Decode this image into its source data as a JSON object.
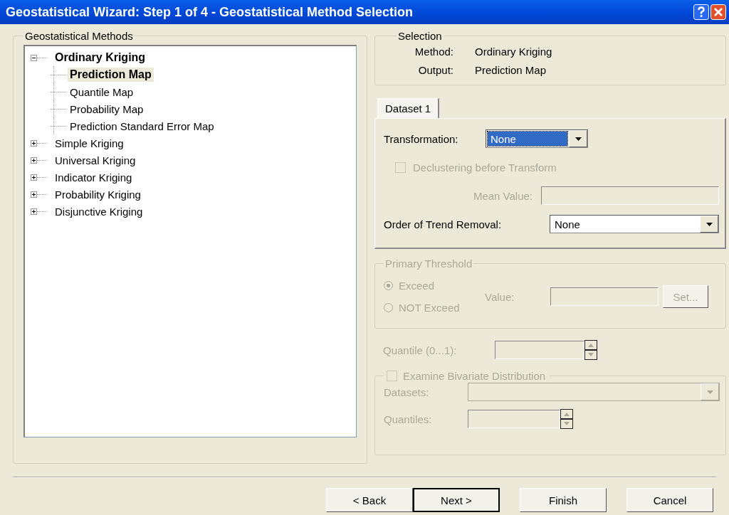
{
  "window": {
    "title": "Geostatistical Wizard: Step 1 of 4 - Geostatistical Method Selection"
  },
  "methods": {
    "title": "Geostatistical Methods",
    "tree": [
      {
        "label": "Ordinary Kriging",
        "expanded": true,
        "selected": false,
        "children": [
          {
            "label": "Prediction Map",
            "selected": true
          },
          {
            "label": "Quantile Map",
            "selected": false
          },
          {
            "label": "Probability Map",
            "selected": false
          },
          {
            "label": "Prediction Standard Error Map",
            "selected": false
          }
        ]
      },
      {
        "label": "Simple Kriging",
        "expanded": false,
        "selected": false
      },
      {
        "label": "Universal Kriging",
        "expanded": false,
        "selected": false
      },
      {
        "label": "Indicator Kriging",
        "expanded": false,
        "selected": false
      },
      {
        "label": "Probability Kriging",
        "expanded": false,
        "selected": false
      },
      {
        "label": "Disjunctive Kriging",
        "expanded": false,
        "selected": false
      }
    ]
  },
  "selection": {
    "title": "Selection",
    "rows": [
      {
        "label": "Method:",
        "value": "Ordinary Kriging"
      },
      {
        "label": "Output:",
        "value": "Prediction Map"
      }
    ]
  },
  "tabs": [
    {
      "label": "Dataset 1",
      "selected": true
    }
  ],
  "dataset": {
    "transformation": {
      "label": "Transformation:",
      "value": "None",
      "focused": true
    },
    "declustering": {
      "label": "Declustering before Transform",
      "checked": false,
      "disabled": true
    },
    "mean_value": {
      "label": "Mean Value:",
      "disabled": true
    },
    "trend": {
      "label": "Order of Trend Removal:",
      "value": "None",
      "focused": false
    }
  },
  "primary_threshold": {
    "title": "Primary Threshold",
    "disabled": true,
    "options": [
      {
        "label": "Exceed",
        "selected": true
      },
      {
        "label": "NOT Exceed",
        "selected": false
      }
    ],
    "value_label": "Value:",
    "set_button": "Set..."
  },
  "quantile": {
    "label": "Quantile (0...1):",
    "disabled": true
  },
  "bivariate": {
    "label": "Examine Bivariate Distribution",
    "checked": false,
    "disabled": true,
    "datasets_label": "Datasets:",
    "quantiles_label": "Quantiles:"
  },
  "buttons": [
    {
      "label": "< Back",
      "default": false
    },
    {
      "label": "Next >",
      "default": true
    },
    {
      "label": "Finish",
      "default": false
    },
    {
      "label": "Cancel",
      "default": false
    }
  ]
}
